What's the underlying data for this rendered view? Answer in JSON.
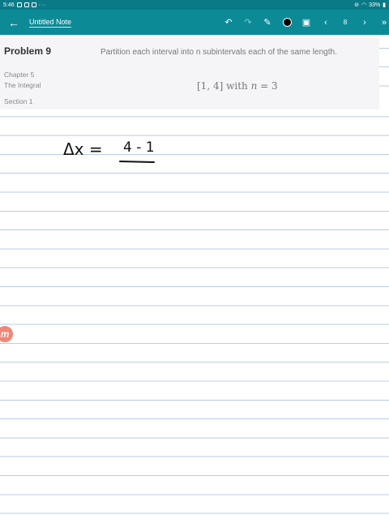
{
  "status": {
    "time": "5:46",
    "dots": "···",
    "battery": "33%"
  },
  "toolbar": {
    "back_icon": "arrow-left-icon",
    "title": "Untitled Note",
    "page_number": "8"
  },
  "problem": {
    "title": "Problem 9",
    "chapter": "Chapter 5",
    "chapter_title": "The Integral",
    "section": "Section 1",
    "text": "Partition each interval into n subintervals each of the same length.",
    "math_interval": "[1, 4]",
    "math_with": "with",
    "math_var": "n",
    "math_eq": "= 3"
  },
  "handwriting": {
    "lhs": "Δx =",
    "numerator": "4 - 1"
  },
  "logo": {
    "letter": "m"
  },
  "colors": {
    "toolbar": "#0c8b97",
    "statusbar": "#0a7a87",
    "rule_line": "#b9cde6",
    "logo": "#f08678"
  }
}
